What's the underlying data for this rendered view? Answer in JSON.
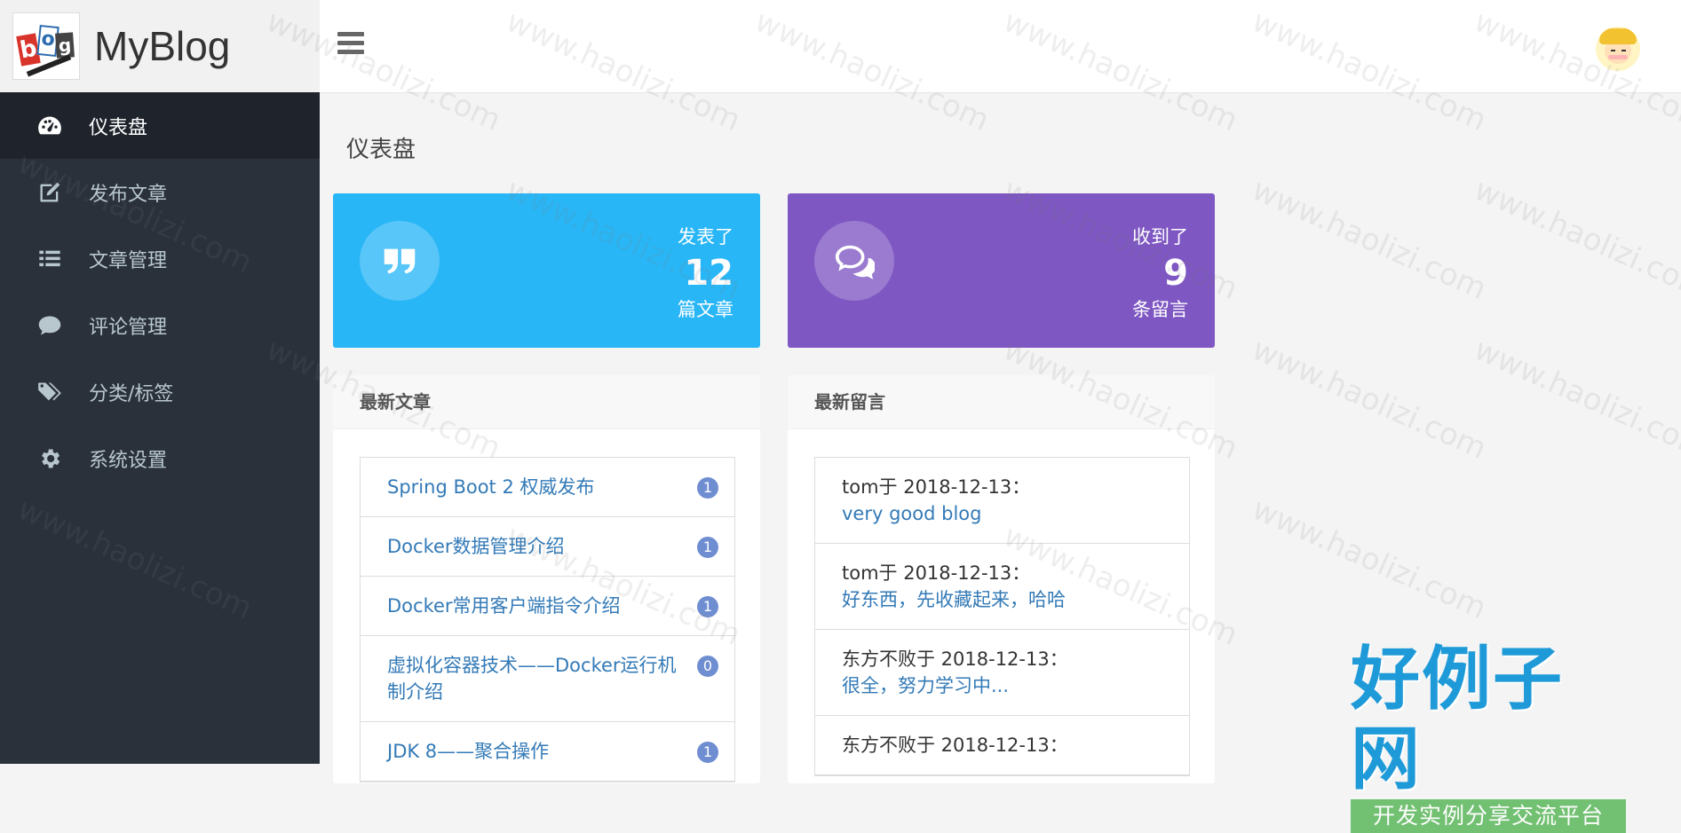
{
  "brand": {
    "logo_text": "blog",
    "name": "MyBlog"
  },
  "sidebar": {
    "items": [
      {
        "label": "仪表盘",
        "icon": "dashboard-icon",
        "active": true
      },
      {
        "label": "发布文章",
        "icon": "edit-icon"
      },
      {
        "label": "文章管理",
        "icon": "list-icon"
      },
      {
        "label": "评论管理",
        "icon": "comment-icon"
      },
      {
        "label": "分类/标签",
        "icon": "tags-icon"
      },
      {
        "label": "系统设置",
        "icon": "gear-icon"
      }
    ]
  },
  "page": {
    "title": "仪表盘"
  },
  "stats": {
    "articles": {
      "label": "发表了",
      "count": "12",
      "unit": "篇文章",
      "color": "#29b6f6",
      "icon": "quote-icon"
    },
    "comments": {
      "label": "收到了",
      "count": "9",
      "unit": "条留言",
      "color": "#7e57c2",
      "icon": "chat-bubbles-icon"
    }
  },
  "latest_articles": {
    "title": "最新文章",
    "items": [
      {
        "title": "Spring Boot 2 权威发布",
        "count": "1"
      },
      {
        "title": "Docker数据管理介绍",
        "count": "1"
      },
      {
        "title": "Docker常用客户端指令介绍",
        "count": "1"
      },
      {
        "title": "虚拟化容器技术——Docker运行机制介绍",
        "count": "0"
      },
      {
        "title": "JDK 8——聚合操作",
        "count": "1"
      }
    ]
  },
  "latest_comments": {
    "title": "最新留言",
    "items": [
      {
        "meta": "tom于 2018-12-13：",
        "body": "very good blog"
      },
      {
        "meta": "tom于 2018-12-13：",
        "body": "好东西，先收藏起来，哈哈"
      },
      {
        "meta": "东方不败于 2018-12-13：",
        "body": "很全，努力学习中..."
      },
      {
        "meta": "东方不败于 2018-12-13：",
        "body": ""
      }
    ]
  },
  "watermark": {
    "text": "www.haolizi.com",
    "corner_title": "好例子网",
    "corner_subtitle": "开发实例分享交流平台"
  }
}
